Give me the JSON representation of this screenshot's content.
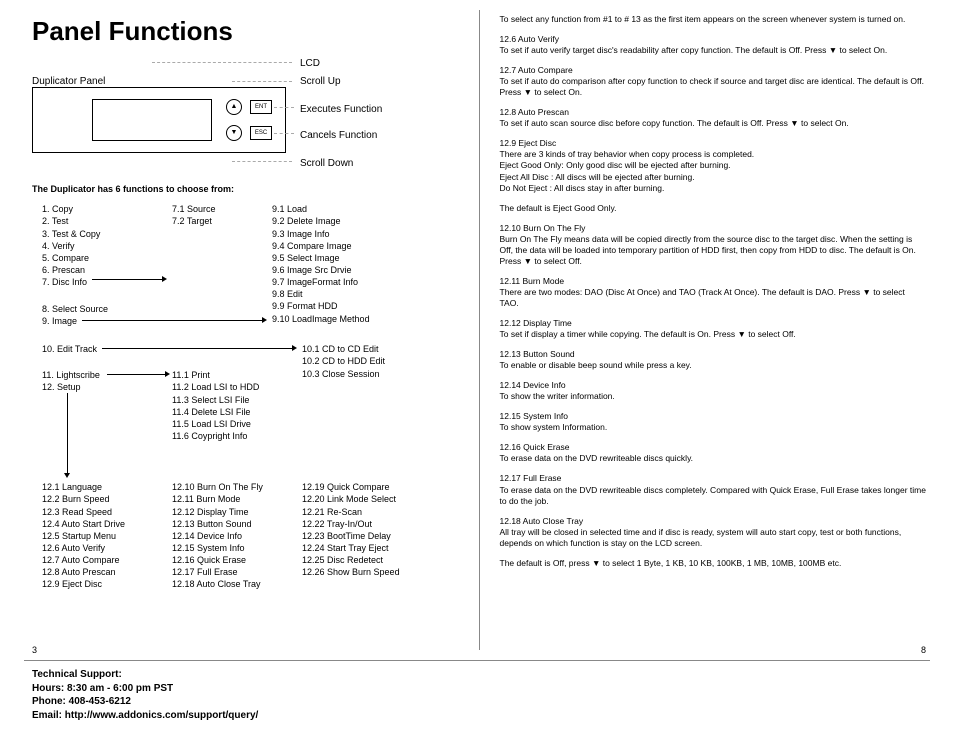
{
  "title": "Panel Functions",
  "panel": {
    "duplicator_label": "Duplicator Panel",
    "lcd_label": "LCD",
    "scroll_up": "Scroll Up",
    "executes": "Executes Function",
    "cancels": "Cancels Function",
    "scroll_down": "Scroll Down",
    "ent": "ENT",
    "esc": "ESC",
    "up": "▲",
    "down": "▼"
  },
  "instr": "The Duplicator has 6 functions to choose from:",
  "main_fns": [
    "1. Copy",
    "2. Test",
    "3. Test & Copy",
    "4. Verify",
    "5. Compare",
    "6. Prescan",
    "7. Disc Info"
  ],
  "main_fns2": [
    "8. Select Source",
    "9. Image"
  ],
  "edit_track": "10. Edit Track",
  "main_fns3": [
    "11. Lightscribe",
    "12. Setup"
  ],
  "sub7": [
    "7.1 Source",
    "7.2 Target"
  ],
  "sub9": [
    "9.1 Load",
    "9.2 Delete Image",
    "9.3 Image Info",
    "9.4 Compare Image",
    "9.5 Select Image",
    "9.6 Image Src Drvie",
    "9.7 ImageFormat Info",
    "9.8 Edit",
    "9.9 Format HDD",
    "9.10 LoadImage Method"
  ],
  "sub10": [
    "10.1 CD to CD Edit",
    "10.2 CD to HDD Edit",
    "10.3 Close Session"
  ],
  "sub11": [
    "11.1 Print",
    "11.2 Load LSI to HDD",
    "11.3 Select LSI File",
    "11.4 Delete LSI File",
    "11.5 Load LSI Drive",
    "11.6 Coypright Info"
  ],
  "sub12a": [
    "12.1 Language",
    "12.2 Burn Speed",
    "12.3 Read Speed",
    "12.4 Auto Start Drive",
    "12.5 Startup Menu",
    "12.6 Auto Verify",
    "12.7 Auto Compare",
    "12.8 Auto Prescan",
    "12.9 Eject Disc"
  ],
  "sub12b": [
    "12.10 Burn On The Fly",
    "12.11 Burn Mode",
    "12.12 Display Time",
    "12.13 Button Sound",
    "12.14 Device Info",
    "12.15 System Info",
    "12.16 Quick Erase",
    "12.17 Full Erase",
    "12.18 Auto Close Tray"
  ],
  "sub12c": [
    "12.19 Quick Compare",
    "12.20 Link Mode Select",
    "12.21 Re-Scan",
    "12.22 Tray-In/Out",
    "12.23 BootTime Delay",
    "12.24 Start Tray Eject",
    "12.25 Disc Redetect",
    "12.26 Show Burn Speed"
  ],
  "page_left": "3",
  "page_right": "8",
  "right": {
    "intro": "To select any function from #1 to # 13 as the first item appears on the screen whenever system is turned on.",
    "s126h": "12.6 Auto Verify",
    "s126": "To set if auto verify target disc's readability after copy function. The default is Off. Press ▼ to select On.",
    "s127h": "12.7 Auto Compare",
    "s127": "To set if auto do comparison after copy function to check if source and target disc are identical. The default is Off. Press ▼ to select On.",
    "s128h": "12.8 Auto Prescan",
    "s128": "To set if auto scan source disc before copy function. The default is Off. Press ▼ to select On.",
    "s129h": "12.9 Eject Disc",
    "s129a": "There are 3 kinds of tray behavior when copy process is completed.",
    "s129b": "Eject Good Only: Only good disc will be ejected after burning.",
    "s129c": "Eject All Disc : All discs will be ejected after burning.",
    "s129d": "Do Not Eject : All discs stay in after burning.",
    "s129e": "The default is Eject Good Only.",
    "s1210h": "12.10 Burn On The Fly",
    "s1210": "Burn On The Fly means data will be copied directly from the source disc to the target disc. When the setting is Off, the data will be loaded into temporary partition of HDD first, then copy from HDD to disc. The default is On. Press ▼ to select Off.",
    "s1211h": "12.11 Burn Mode",
    "s1211": "There are two modes: DAO (Disc At Once) and TAO (Track At Once). The default is DAO. Press ▼ to select TAO.",
    "s1212h": "12.12 Display Time",
    "s1212": "To set if display a timer while copying. The default is On. Press ▼ to select Off.",
    "s1213h": "12.13 Button Sound",
    "s1213": "To enable or disable beep sound while press a key.",
    "s1214h": "12.14 Device Info",
    "s1214": "To show the writer information.",
    "s1215h": "12.15 System Info",
    "s1215": "To show system Information.",
    "s1216h": "12.16 Quick Erase",
    "s1216": "To erase data on the DVD rewriteable discs quickly.",
    "s1217h": "12.17 Full Erase",
    "s1217": "To erase data on the DVD rewriteable discs completely. Compared with Quick Erase, Full Erase takes longer time to do the job.",
    "s1218h": "12.18 Auto Close Tray",
    "s1218": "All tray will be closed in selected time and if disc is ready, system will auto start copy, test or both functions, depends on which function is stay on the LCD screen.",
    "s1218b": "The default is Off, press ▼ to select 1 Byte, 1 KB, 10 KB, 100KB, 1 MB, 10MB, 100MB etc."
  },
  "footer": {
    "l1": "Technical Support:",
    "l2": "Hours:  8:30 am - 6:00 pm PST",
    "l3": "Phone: 408-453-6212",
    "l4": "Email:  http://www.addonics.com/support/query/"
  }
}
